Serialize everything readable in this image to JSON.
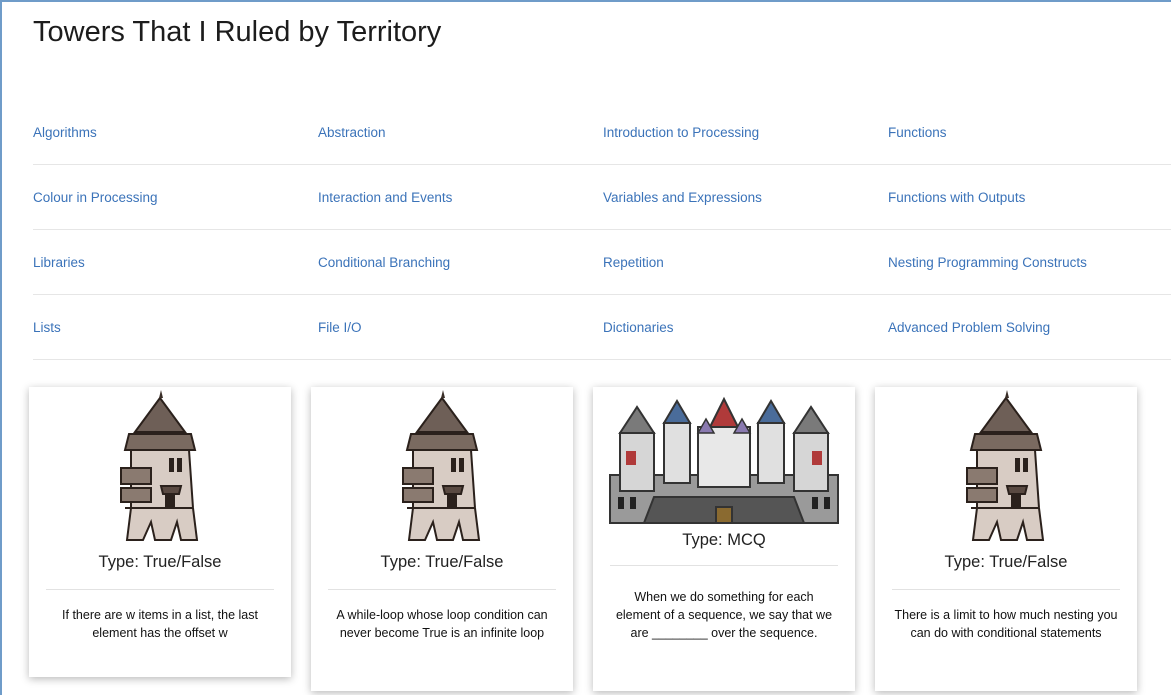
{
  "title": "Towers That I Ruled by Territory",
  "topics": [
    [
      "Algorithms",
      "Abstraction",
      "Introduction to Processing",
      "Functions"
    ],
    [
      "Colour in Processing",
      "Interaction and Events",
      "Variables and Expressions",
      "Functions with Outputs"
    ],
    [
      "Libraries",
      "Conditional Branching",
      "Repetition",
      "Nesting Programming Constructs"
    ],
    [
      "Lists",
      "File I/O",
      "Dictionaries",
      "Advanced Problem Solving"
    ]
  ],
  "cards": [
    {
      "image": "tower-icon",
      "type": "Type: True/False",
      "text": "If there are w items in a list, the last element has the offset w"
    },
    {
      "image": "tower-icon",
      "type": "Type: True/False",
      "text": "A while-loop whose loop condition can never become True is an infinite loop"
    },
    {
      "image": "castle-icon",
      "type": "Type: MCQ",
      "text": "When we do something for each element of a sequence, we say that we are ________ over the sequence."
    },
    {
      "image": "tower-icon",
      "type": "Type: True/False",
      "text": "There is a limit to how much nesting you can do with conditional statements"
    }
  ]
}
